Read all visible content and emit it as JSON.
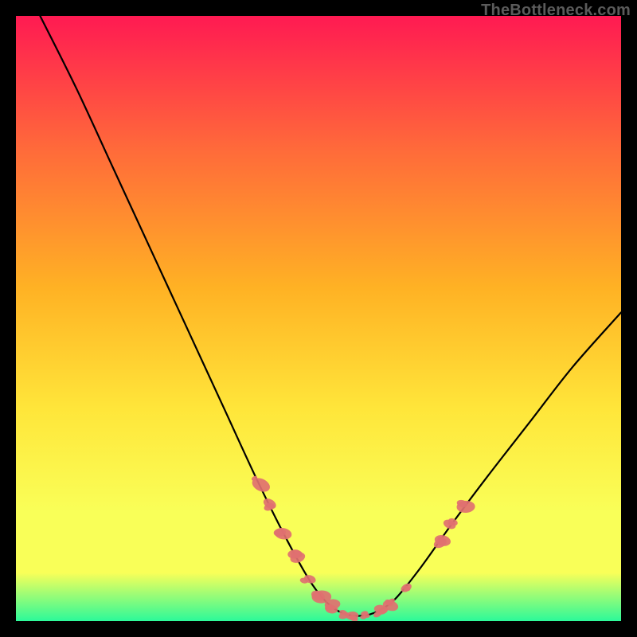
{
  "watermark": "TheBottleneck.com",
  "chart_data": {
    "type": "line",
    "title": "",
    "xlabel": "",
    "ylabel": "",
    "xlim": [
      0,
      100
    ],
    "ylim": [
      0,
      100
    ],
    "grid": false,
    "legend": false,
    "background_gradient": {
      "top_color": "#ff1a52",
      "mid_colors": [
        "#ff6a3a",
        "#ffb224",
        "#ffe63a",
        "#f9ff58"
      ],
      "bottom_color": "#2cf99a"
    },
    "series": [
      {
        "name": "bottleneck-curve",
        "color": "#000000",
        "x": [
          4,
          10,
          16,
          22,
          28,
          34,
          40,
          45,
          49,
          52,
          55,
          58,
          60.5,
          63,
          67,
          72,
          78,
          85,
          92,
          100
        ],
        "y": [
          100,
          88,
          75,
          62,
          49,
          36,
          23,
          13,
          6,
          2.5,
          1,
          1,
          2,
          4,
          9,
          16,
          24,
          33,
          42,
          51
        ]
      }
    ],
    "highlight_dots": {
      "color": "#e07070",
      "radius_range": [
        3,
        6
      ],
      "points": [
        {
          "x": 40,
          "y": 23
        },
        {
          "x": 42,
          "y": 19
        },
        {
          "x": 44,
          "y": 15
        },
        {
          "x": 46,
          "y": 11
        },
        {
          "x": 48,
          "y": 7
        },
        {
          "x": 50,
          "y": 4
        },
        {
          "x": 52,
          "y": 2.5
        },
        {
          "x": 54,
          "y": 1.5
        },
        {
          "x": 56,
          "y": 1
        },
        {
          "x": 58,
          "y": 1
        },
        {
          "x": 60,
          "y": 1.5
        },
        {
          "x": 62,
          "y": 3
        },
        {
          "x": 64,
          "y": 5
        },
        {
          "x": 70,
          "y": 13
        },
        {
          "x": 72,
          "y": 16
        },
        {
          "x": 74,
          "y": 19
        }
      ]
    }
  }
}
